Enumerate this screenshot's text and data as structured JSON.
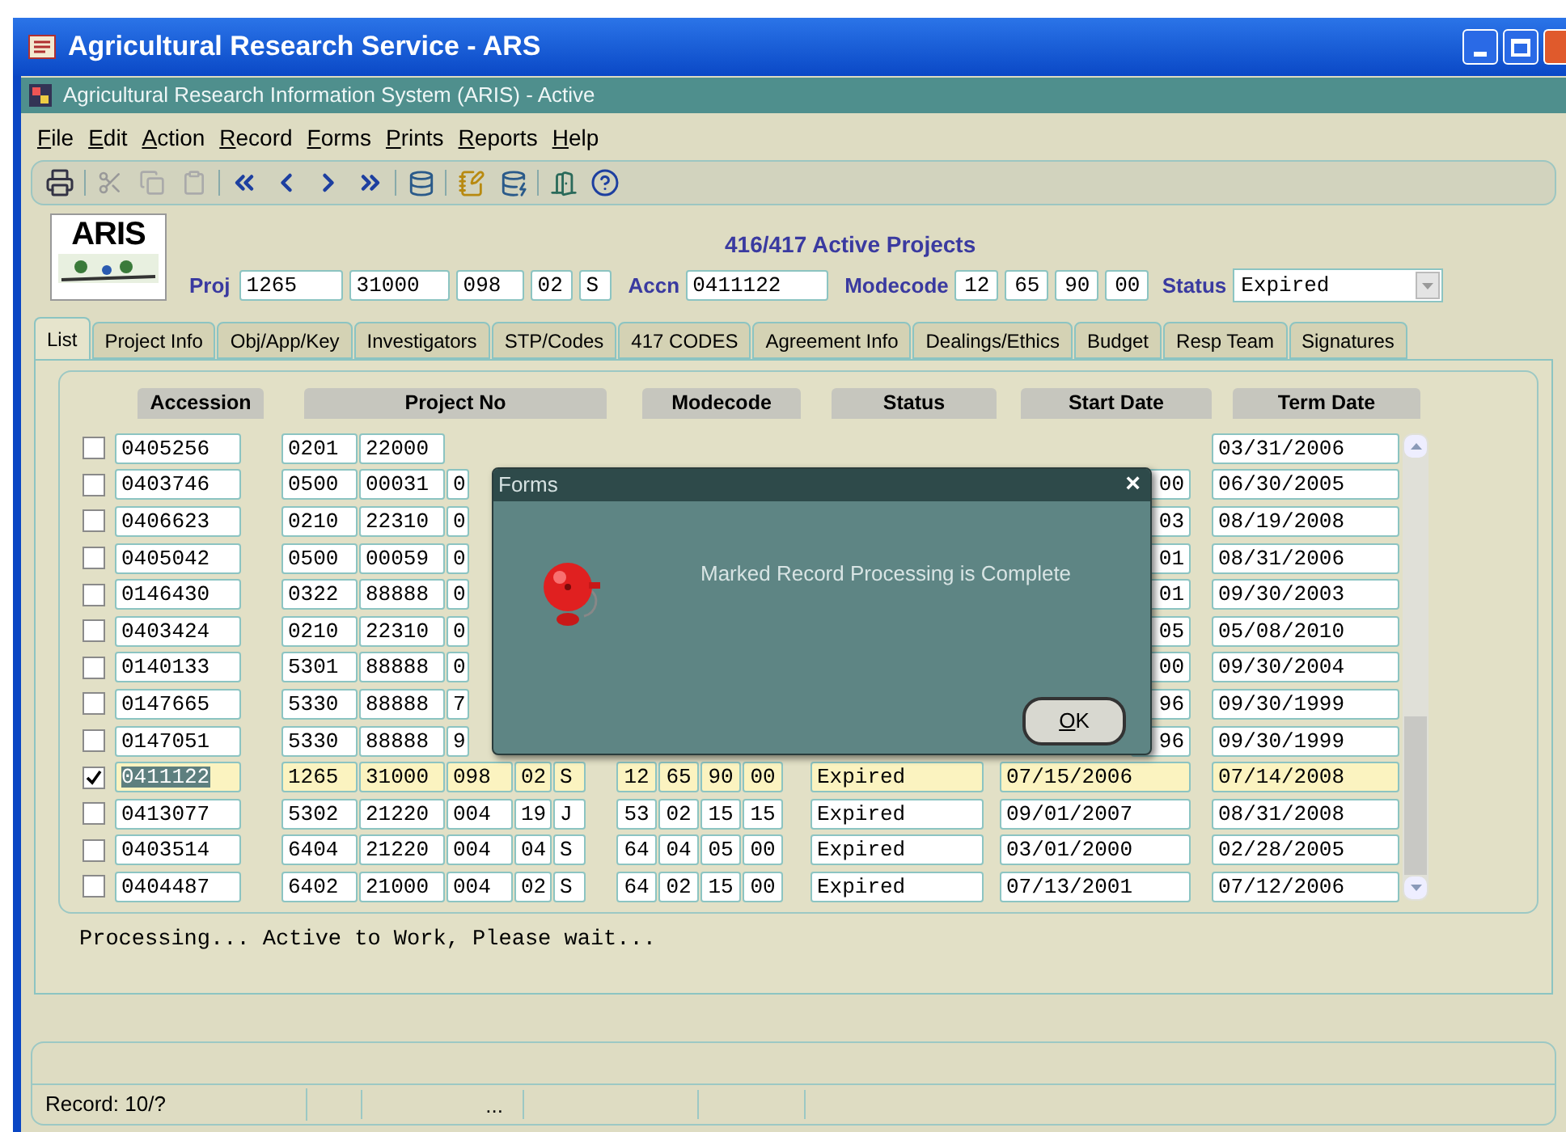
{
  "window": {
    "title": "Agricultural Research Service - ARS",
    "subtitle": "Agricultural Research Information System (ARIS) - Active"
  },
  "menu": [
    "File",
    "Edit",
    "Action",
    "Record",
    "Forms",
    "Prints",
    "Reports",
    "Help"
  ],
  "header": {
    "logo": "ARIS",
    "title": "416/417 Active Projects",
    "proj": {
      "label": "Proj",
      "values": [
        "1265",
        "31000",
        "098",
        "02",
        "S"
      ]
    },
    "accn": {
      "label": "Accn",
      "value": "0411122"
    },
    "modecode": {
      "label": "Modecode",
      "values": [
        "12",
        "65",
        "90",
        "00"
      ]
    },
    "status": {
      "label": "Status",
      "value": "Expired"
    }
  },
  "tabs": [
    {
      "label": "List",
      "selected": true
    },
    {
      "label": "Project Info",
      "selected": false
    },
    {
      "label": "Obj/App/Key",
      "selected": false
    },
    {
      "label": "Investigators",
      "selected": false
    },
    {
      "label": "STP/Codes",
      "selected": false
    },
    {
      "label": "417 CODES",
      "selected": false
    },
    {
      "label": "Agreement Info",
      "selected": false
    },
    {
      "label": "Dealings/Ethics",
      "selected": false
    },
    {
      "label": "Budget",
      "selected": false
    },
    {
      "label": "Resp Team",
      "selected": false
    },
    {
      "label": "Signatures",
      "selected": false
    }
  ],
  "table": {
    "columns": [
      "Accession",
      "Project No",
      "Modecode",
      "Status",
      "Start Date",
      "Term Date"
    ],
    "rows": [
      {
        "checked": false,
        "selected": false,
        "accession": "0405256",
        "project": [
          "0201",
          "22000"
        ],
        "term_date": "03/31/2006"
      },
      {
        "checked": false,
        "selected": false,
        "accession": "0403746",
        "project": [
          "0500",
          "00031",
          "0"
        ],
        "start_date": "00",
        "term_date": "06/30/2005"
      },
      {
        "checked": false,
        "selected": false,
        "accession": "0406623",
        "project": [
          "0210",
          "22310",
          "0"
        ],
        "start_date": "03",
        "term_date": "08/19/2008"
      },
      {
        "checked": false,
        "selected": false,
        "accession": "0405042",
        "project": [
          "0500",
          "00059",
          "0"
        ],
        "start_date": "01",
        "term_date": "08/31/2006"
      },
      {
        "checked": false,
        "selected": false,
        "accession": "0146430",
        "project": [
          "0322",
          "88888",
          "0"
        ],
        "start_date": "01",
        "term_date": "09/30/2003"
      },
      {
        "checked": false,
        "selected": false,
        "accession": "0403424",
        "project": [
          "0210",
          "22310",
          "0"
        ],
        "start_date": "05",
        "term_date": "05/08/2010"
      },
      {
        "checked": false,
        "selected": false,
        "accession": "0140133",
        "project": [
          "5301",
          "88888",
          "0"
        ],
        "start_date": "00",
        "term_date": "09/30/2004"
      },
      {
        "checked": false,
        "selected": false,
        "accession": "0147665",
        "project": [
          "5330",
          "88888",
          "7"
        ],
        "start_date": "96",
        "term_date": "09/30/1999"
      },
      {
        "checked": false,
        "selected": false,
        "accession": "0147051",
        "project": [
          "5330",
          "88888",
          "9"
        ],
        "start_date": "96",
        "term_date": "09/30/1999"
      },
      {
        "checked": true,
        "selected": true,
        "accession": "0411122",
        "project": [
          "1265",
          "31000",
          "098",
          "02",
          "S"
        ],
        "modecode": [
          "12",
          "65",
          "90",
          "00"
        ],
        "status": "Expired",
        "start_date": "07/15/2006",
        "term_date": "07/14/2008"
      },
      {
        "checked": false,
        "selected": false,
        "accession": "0413077",
        "project": [
          "5302",
          "21220",
          "004",
          "19",
          "J"
        ],
        "modecode": [
          "53",
          "02",
          "15",
          "15"
        ],
        "status": "Expired",
        "start_date": "09/01/2007",
        "term_date": "08/31/2008"
      },
      {
        "checked": false,
        "selected": false,
        "accession": "0403514",
        "project": [
          "6404",
          "21220",
          "004",
          "04",
          "S"
        ],
        "modecode": [
          "64",
          "04",
          "05",
          "00"
        ],
        "status": "Expired",
        "start_date": "03/01/2000",
        "term_date": "02/28/2005"
      },
      {
        "checked": false,
        "selected": false,
        "accession": "0404487",
        "project": [
          "6402",
          "21000",
          "004",
          "02",
          "S"
        ],
        "modecode": [
          "64",
          "02",
          "15",
          "00"
        ],
        "status": "Expired",
        "start_date": "07/13/2001",
        "term_date": "07/12/2006"
      }
    ]
  },
  "message": "Processing... Active to Work, Please wait...",
  "dialog": {
    "title": "Forms",
    "close": "×",
    "message": "Marked Record Processing is Complete",
    "button": "OK"
  },
  "status_bar": {
    "record": "Record: 10/?",
    "ellipsis": "..."
  }
}
